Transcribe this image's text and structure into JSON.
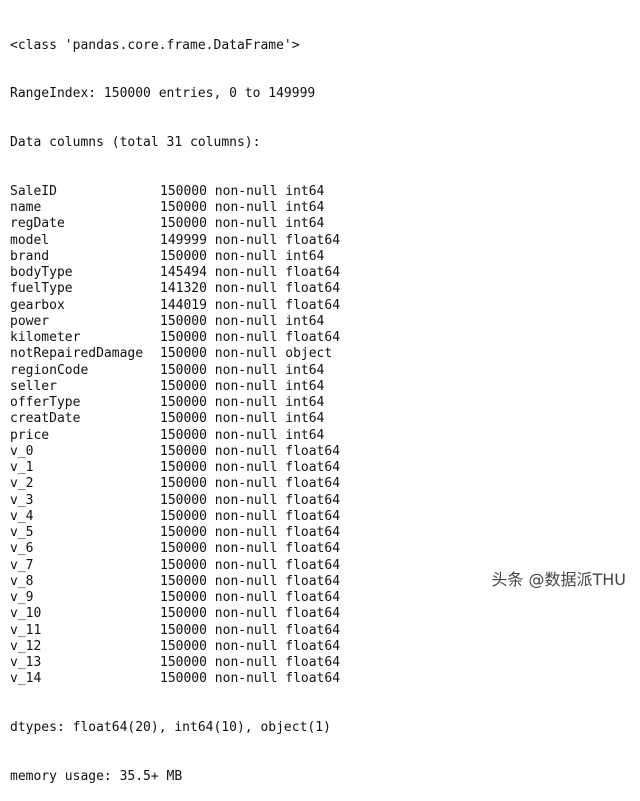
{
  "header": {
    "class_line": "<class 'pandas.core.frame.DataFrame'>",
    "range_index": "RangeIndex: 150000 entries, 0 to 149999",
    "data_columns": "Data columns (total 31 columns):"
  },
  "columns": [
    {
      "name": "SaleID",
      "count": "150000",
      "null_label": "non-null",
      "dtype": "int64"
    },
    {
      "name": "name",
      "count": "150000",
      "null_label": "non-null",
      "dtype": "int64"
    },
    {
      "name": "regDate",
      "count": "150000",
      "null_label": "non-null",
      "dtype": "int64"
    },
    {
      "name": "model",
      "count": "149999",
      "null_label": "non-null",
      "dtype": "float64"
    },
    {
      "name": "brand",
      "count": "150000",
      "null_label": "non-null",
      "dtype": "int64"
    },
    {
      "name": "bodyType",
      "count": "145494",
      "null_label": "non-null",
      "dtype": "float64"
    },
    {
      "name": "fuelType",
      "count": "141320",
      "null_label": "non-null",
      "dtype": "float64"
    },
    {
      "name": "gearbox",
      "count": "144019",
      "null_label": "non-null",
      "dtype": "float64"
    },
    {
      "name": "power",
      "count": "150000",
      "null_label": "non-null",
      "dtype": "int64"
    },
    {
      "name": "kilometer",
      "count": "150000",
      "null_label": "non-null",
      "dtype": "float64"
    },
    {
      "name": "notRepairedDamage",
      "count": "150000",
      "null_label": "non-null",
      "dtype": "object"
    },
    {
      "name": "regionCode",
      "count": "150000",
      "null_label": "non-null",
      "dtype": "int64"
    },
    {
      "name": "seller",
      "count": "150000",
      "null_label": "non-null",
      "dtype": "int64"
    },
    {
      "name": "offerType",
      "count": "150000",
      "null_label": "non-null",
      "dtype": "int64"
    },
    {
      "name": "creatDate",
      "count": "150000",
      "null_label": "non-null",
      "dtype": "int64"
    },
    {
      "name": "price",
      "count": "150000",
      "null_label": "non-null",
      "dtype": "int64"
    },
    {
      "name": "v_0",
      "count": "150000",
      "null_label": "non-null",
      "dtype": "float64"
    },
    {
      "name": "v_1",
      "count": "150000",
      "null_label": "non-null",
      "dtype": "float64"
    },
    {
      "name": "v_2",
      "count": "150000",
      "null_label": "non-null",
      "dtype": "float64"
    },
    {
      "name": "v_3",
      "count": "150000",
      "null_label": "non-null",
      "dtype": "float64"
    },
    {
      "name": "v_4",
      "count": "150000",
      "null_label": "non-null",
      "dtype": "float64"
    },
    {
      "name": "v_5",
      "count": "150000",
      "null_label": "non-null",
      "dtype": "float64"
    },
    {
      "name": "v_6",
      "count": "150000",
      "null_label": "non-null",
      "dtype": "float64"
    },
    {
      "name": "v_7",
      "count": "150000",
      "null_label": "non-null",
      "dtype": "float64"
    },
    {
      "name": "v_8",
      "count": "150000",
      "null_label": "non-null",
      "dtype": "float64"
    },
    {
      "name": "v_9",
      "count": "150000",
      "null_label": "non-null",
      "dtype": "float64"
    },
    {
      "name": "v_10",
      "count": "150000",
      "null_label": "non-null",
      "dtype": "float64"
    },
    {
      "name": "v_11",
      "count": "150000",
      "null_label": "non-null",
      "dtype": "float64"
    },
    {
      "name": "v_12",
      "count": "150000",
      "null_label": "non-null",
      "dtype": "float64"
    },
    {
      "name": "v_13",
      "count": "150000",
      "null_label": "non-null",
      "dtype": "float64"
    },
    {
      "name": "v_14",
      "count": "150000",
      "null_label": "non-null",
      "dtype": "float64"
    }
  ],
  "footer": {
    "dtypes": "dtypes: float64(20), int64(10), object(1)",
    "memory": "memory usage: 35.5+ MB"
  },
  "watermark": "头条 @数据派THU"
}
